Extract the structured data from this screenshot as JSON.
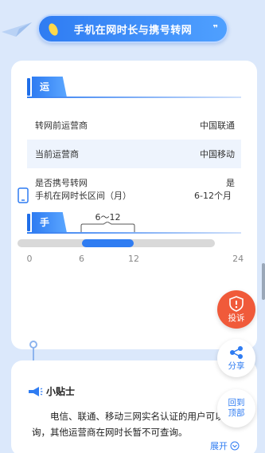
{
  "header": {
    "title": "手机在网时长与携号转网",
    "quote_mark": "❞"
  },
  "carrier_section": {
    "title": "运营商类型",
    "rows": [
      {
        "label": "转网前运营商",
        "value": "中国联通"
      },
      {
        "label": "当前运营商",
        "value": "中国移动"
      },
      {
        "label": "是否携号转网",
        "value": "是"
      }
    ]
  },
  "duration_section": {
    "title": "手机在网时长",
    "range_label": "手机在网时长区间（月）",
    "range_value": "6-12个月",
    "slider_tip": "6～12",
    "slider_range_months": [
      6,
      12
    ],
    "axis_max_months": 30,
    "ticks": [
      {
        "label": "0",
        "value": 0
      },
      {
        "label": "6",
        "value": 6
      },
      {
        "label": "12",
        "value": 12
      },
      {
        "label": "24",
        "value": 24
      }
    ]
  },
  "tips": {
    "title": "小贴士",
    "body": "电信、联通、移动三网实名认证的用户可以查询，其他运营商在网时长暂不可查询。",
    "expand_label": "展开"
  },
  "float_buttons": {
    "complain_label": "投诉",
    "share_label": "分享",
    "top_label_1": "回到",
    "top_label_2": "顶部"
  },
  "colors": {
    "accent": "#2f7cf2",
    "complain": "#f05a3a",
    "background": "#dbe8fb"
  }
}
